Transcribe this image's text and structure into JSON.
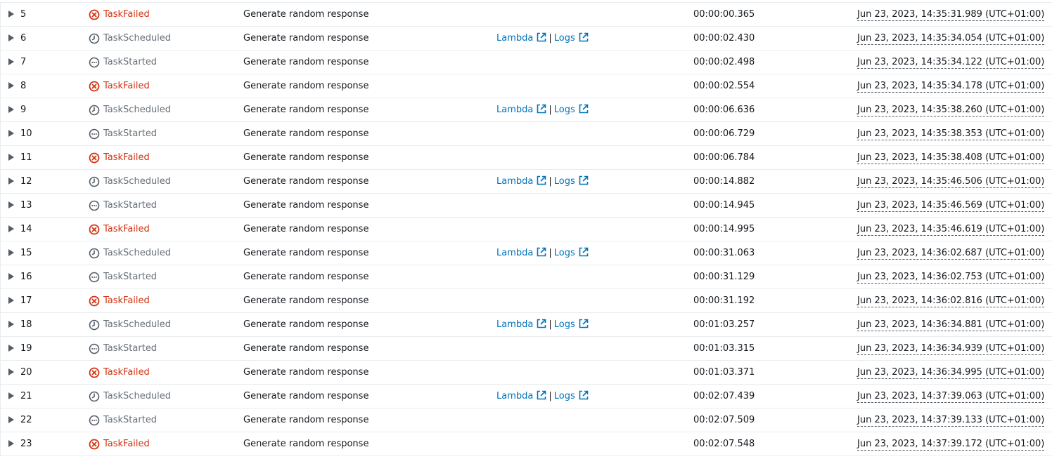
{
  "colors": {
    "failed": "#d13212",
    "neutral": "#687078",
    "link": "#0073bb",
    "border": "#eaeded"
  },
  "icons": {
    "failed": "close-circle-icon",
    "scheduled": "clock-icon",
    "started": "ellipsis-circle-icon",
    "external": "external-link-icon",
    "expand": "caret-right-icon"
  },
  "rows": [
    {
      "id": "5",
      "type": "TaskFailed",
      "kind": "failed",
      "step": "Generate random response",
      "lambda": "",
      "logs": "",
      "sep": "",
      "elapsed": "00:00:00.365",
      "timestamp": "Jun 23, 2023, 14:35:31.989 (UTC+01:00)"
    },
    {
      "id": "6",
      "type": "TaskScheduled",
      "kind": "scheduled",
      "step": "Generate random response",
      "lambda": "Lambda",
      "logs": "Logs",
      "sep": "|",
      "elapsed": "00:00:02.430",
      "timestamp": "Jun 23, 2023, 14:35:34.054 (UTC+01:00)"
    },
    {
      "id": "7",
      "type": "TaskStarted",
      "kind": "started",
      "step": "Generate random response",
      "lambda": "",
      "logs": "",
      "sep": "",
      "elapsed": "00:00:02.498",
      "timestamp": "Jun 23, 2023, 14:35:34.122 (UTC+01:00)"
    },
    {
      "id": "8",
      "type": "TaskFailed",
      "kind": "failed",
      "step": "Generate random response",
      "lambda": "",
      "logs": "",
      "sep": "",
      "elapsed": "00:00:02.554",
      "timestamp": "Jun 23, 2023, 14:35:34.178 (UTC+01:00)"
    },
    {
      "id": "9",
      "type": "TaskScheduled",
      "kind": "scheduled",
      "step": "Generate random response",
      "lambda": "Lambda",
      "logs": "Logs",
      "sep": "|",
      "elapsed": "00:00:06.636",
      "timestamp": "Jun 23, 2023, 14:35:38.260 (UTC+01:00)"
    },
    {
      "id": "10",
      "type": "TaskStarted",
      "kind": "started",
      "step": "Generate random response",
      "lambda": "",
      "logs": "",
      "sep": "",
      "elapsed": "00:00:06.729",
      "timestamp": "Jun 23, 2023, 14:35:38.353 (UTC+01:00)"
    },
    {
      "id": "11",
      "type": "TaskFailed",
      "kind": "failed",
      "step": "Generate random response",
      "lambda": "",
      "logs": "",
      "sep": "",
      "elapsed": "00:00:06.784",
      "timestamp": "Jun 23, 2023, 14:35:38.408 (UTC+01:00)"
    },
    {
      "id": "12",
      "type": "TaskScheduled",
      "kind": "scheduled",
      "step": "Generate random response",
      "lambda": "Lambda",
      "logs": "Logs",
      "sep": "|",
      "elapsed": "00:00:14.882",
      "timestamp": "Jun 23, 2023, 14:35:46.506 (UTC+01:00)"
    },
    {
      "id": "13",
      "type": "TaskStarted",
      "kind": "started",
      "step": "Generate random response",
      "lambda": "",
      "logs": "",
      "sep": "",
      "elapsed": "00:00:14.945",
      "timestamp": "Jun 23, 2023, 14:35:46.569 (UTC+01:00)"
    },
    {
      "id": "14",
      "type": "TaskFailed",
      "kind": "failed",
      "step": "Generate random response",
      "lambda": "",
      "logs": "",
      "sep": "",
      "elapsed": "00:00:14.995",
      "timestamp": "Jun 23, 2023, 14:35:46.619 (UTC+01:00)"
    },
    {
      "id": "15",
      "type": "TaskScheduled",
      "kind": "scheduled",
      "step": "Generate random response",
      "lambda": "Lambda",
      "logs": "Logs",
      "sep": "|",
      "elapsed": "00:00:31.063",
      "timestamp": "Jun 23, 2023, 14:36:02.687 (UTC+01:00)"
    },
    {
      "id": "16",
      "type": "TaskStarted",
      "kind": "started",
      "step": "Generate random response",
      "lambda": "",
      "logs": "",
      "sep": "",
      "elapsed": "00:00:31.129",
      "timestamp": "Jun 23, 2023, 14:36:02.753 (UTC+01:00)"
    },
    {
      "id": "17",
      "type": "TaskFailed",
      "kind": "failed",
      "step": "Generate random response",
      "lambda": "",
      "logs": "",
      "sep": "",
      "elapsed": "00:00:31.192",
      "timestamp": "Jun 23, 2023, 14:36:02.816 (UTC+01:00)"
    },
    {
      "id": "18",
      "type": "TaskScheduled",
      "kind": "scheduled",
      "step": "Generate random response",
      "lambda": "Lambda",
      "logs": "Logs",
      "sep": "|",
      "elapsed": "00:01:03.257",
      "timestamp": "Jun 23, 2023, 14:36:34.881 (UTC+01:00)"
    },
    {
      "id": "19",
      "type": "TaskStarted",
      "kind": "started",
      "step": "Generate random response",
      "lambda": "",
      "logs": "",
      "sep": "",
      "elapsed": "00:01:03.315",
      "timestamp": "Jun 23, 2023, 14:36:34.939 (UTC+01:00)"
    },
    {
      "id": "20",
      "type": "TaskFailed",
      "kind": "failed",
      "step": "Generate random response",
      "lambda": "",
      "logs": "",
      "sep": "",
      "elapsed": "00:01:03.371",
      "timestamp": "Jun 23, 2023, 14:36:34.995 (UTC+01:00)"
    },
    {
      "id": "21",
      "type": "TaskScheduled",
      "kind": "scheduled",
      "step": "Generate random response",
      "lambda": "Lambda",
      "logs": "Logs",
      "sep": "|",
      "elapsed": "00:02:07.439",
      "timestamp": "Jun 23, 2023, 14:37:39.063 (UTC+01:00)"
    },
    {
      "id": "22",
      "type": "TaskStarted",
      "kind": "started",
      "step": "Generate random response",
      "lambda": "",
      "logs": "",
      "sep": "",
      "elapsed": "00:02:07.509",
      "timestamp": "Jun 23, 2023, 14:37:39.133 (UTC+01:00)"
    },
    {
      "id": "23",
      "type": "TaskFailed",
      "kind": "failed",
      "step": "Generate random response",
      "lambda": "",
      "logs": "",
      "sep": "",
      "elapsed": "00:02:07.548",
      "timestamp": "Jun 23, 2023, 14:37:39.172 (UTC+01:00)"
    }
  ]
}
